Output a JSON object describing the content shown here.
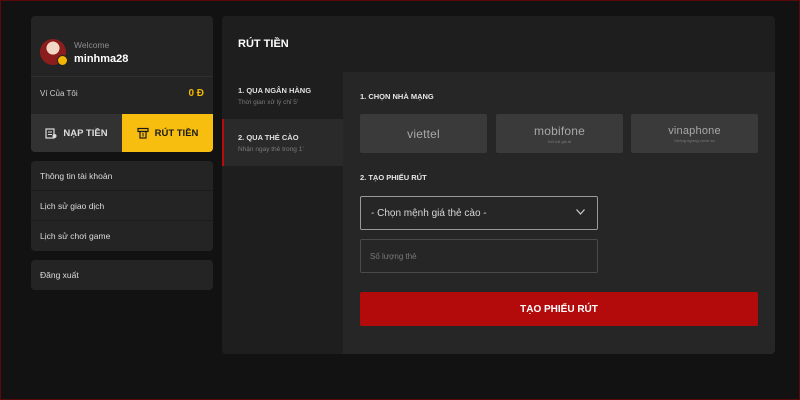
{
  "user": {
    "welcome": "Welcome",
    "username": "minhma28",
    "wallet_label": "Ví Của Tôi",
    "wallet_value": "0 Đ"
  },
  "actions": {
    "deposit_label": "NẠP TIỀN",
    "withdraw_label": "RÚT TIỀN"
  },
  "menu": {
    "items": [
      {
        "label": "Thông tin tài khoản"
      },
      {
        "label": "Lịch sử giao dịch"
      },
      {
        "label": "Lịch sử chơi game"
      }
    ],
    "logout_label": "Đăng xuất"
  },
  "main": {
    "title": "RÚT TIỀN",
    "methods": [
      {
        "name": "1. QUA NGÂN HÀNG",
        "sub": "Thời gian xử lý chỉ 5'"
      },
      {
        "name": "2. QUA THẺ CÀO",
        "sub": "Nhận ngay thẻ trong 1'"
      }
    ],
    "section1_label": "1. CHỌN NHÀ MẠNG",
    "carriers": [
      {
        "name": "viettel",
        "tag": ""
      },
      {
        "name": "mobifone",
        "tag": "Kết nối giá trị"
      },
      {
        "name": "vinaphone",
        "tag": "Không ngừng vươn xa"
      }
    ],
    "section2_label": "2. TẠO PHIẾU RÚT",
    "select_value": "- Chọn mệnh giá thẻ cào -",
    "qty_placeholder": "Số lượng thẻ",
    "submit_label": "TẠO PHIẾU RÚT"
  },
  "colors": {
    "accent_yellow": "#f7bd0f",
    "accent_red": "#b30b0b"
  }
}
